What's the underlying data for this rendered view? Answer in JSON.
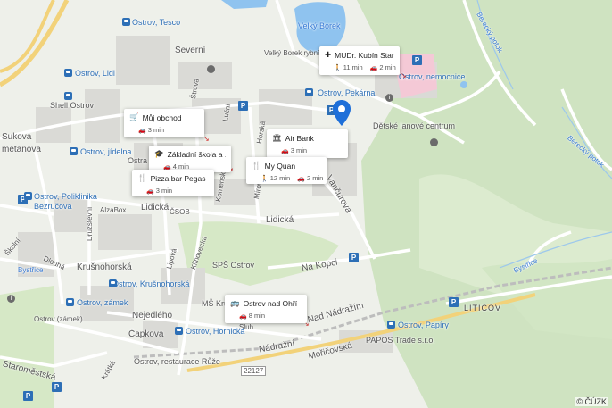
{
  "copyright": "© ČÚZK",
  "street_labels": [
    {
      "id": "sever",
      "text": "Severní"
    },
    {
      "id": "sukova",
      "text": "Sukova"
    },
    {
      "id": "smetanova",
      "text": "metanova"
    },
    {
      "id": "lidicka1",
      "text": "Lidická"
    },
    {
      "id": "lidicka2",
      "text": "Lidická"
    },
    {
      "id": "csob",
      "text": "ČSOB"
    },
    {
      "id": "druzstevni",
      "text": "Družstevní"
    },
    {
      "id": "krusnohorska",
      "text": "Krušnohorská"
    },
    {
      "id": "dlouha",
      "text": "Dlouhá"
    },
    {
      "id": "skolni",
      "text": "Školní"
    },
    {
      "id": "lipova",
      "text": "Lipová"
    },
    {
      "id": "klinovecka",
      "text": "Klínovecká"
    },
    {
      "id": "nakopci",
      "text": "Na Kopci"
    },
    {
      "id": "nejedleho",
      "text": "Nejedlého"
    },
    {
      "id": "capkova",
      "text": "Čapkova"
    },
    {
      "id": "staromestska",
      "text": "Staroměstská"
    },
    {
      "id": "krala",
      "text": "Krátká"
    },
    {
      "id": "nadrazni",
      "text": "Nádražní"
    },
    {
      "id": "nadnadrazim",
      "text": "Nad Nádražím"
    },
    {
      "id": "mostecka",
      "text": "Mořičovská"
    },
    {
      "id": "vancurova",
      "text": "Vančurova"
    },
    {
      "id": "horska",
      "text": "Horská"
    },
    {
      "id": "lucni",
      "text": "Luční"
    },
    {
      "id": "strova",
      "text": "Štrova"
    },
    {
      "id": "komenskeho",
      "text": "Komenského"
    },
    {
      "id": "mirova",
      "text": "Mírová"
    },
    {
      "id": "route",
      "text": "22127"
    },
    {
      "id": "berecky",
      "text": "Berecký potok"
    },
    {
      "id": "bystrice",
      "text": "Bystřice"
    },
    {
      "id": "bystrice2",
      "text": "Bystřice"
    },
    {
      "id": "sluh",
      "text": "Sluh"
    }
  ],
  "poi_labels": [
    {
      "id": "tesco",
      "text": "Ostrov, Tesco"
    },
    {
      "id": "lidl",
      "text": "Ostrov, Lidl"
    },
    {
      "id": "shell",
      "text": "Shell Ostrov"
    },
    {
      "id": "jidelna",
      "text": "Ostrov, jídelna"
    },
    {
      "id": "poliklinika",
      "text": "Ostrov, Poliklinika"
    },
    {
      "id": "bezrucova",
      "text": "Bezručova"
    },
    {
      "id": "alzabox",
      "text": "AlzaBox"
    },
    {
      "id": "pekarna",
      "text": "Ostrov, Pekárna"
    },
    {
      "id": "nemocnice",
      "text": "Ostrov, nemocnice"
    },
    {
      "id": "lanove",
      "text": "Dětské lanové centrum"
    },
    {
      "id": "zamek",
      "text": "Ostrov, zámek"
    },
    {
      "id": "zamek2",
      "text": "Ostrov (zámek)"
    },
    {
      "id": "krusnohorska",
      "text": "Ostrov, Krušnohorská"
    },
    {
      "id": "sps",
      "text": "SPŠ Ostrov"
    },
    {
      "id": "ms",
      "text": "MŠ Krus"
    },
    {
      "id": "hornicka",
      "text": "Ostrov, Hornická"
    },
    {
      "id": "ruze",
      "text": "Ostrov, restaurace Růže"
    },
    {
      "id": "papiry",
      "text": "Ostrov, Papíry"
    },
    {
      "id": "papos",
      "text": "PAPOS Trade s.r.o."
    },
    {
      "id": "velkyborek",
      "text": "Velký Borek"
    },
    {
      "id": "rybnik",
      "text": "Velký Borek rybník"
    },
    {
      "id": "liticov",
      "text": "LITICOV"
    },
    {
      "id": "stra",
      "text": "Ostra"
    }
  ],
  "cards": [
    {
      "id": "mudr",
      "title": "MUDr. Kubín Stan...",
      "icon": "✚",
      "walk": "11 min",
      "car": "2 min"
    },
    {
      "id": "obchod",
      "title": "Můj obchod",
      "icon": "🛒",
      "walk": "",
      "car": "3 min"
    },
    {
      "id": "airbank",
      "title": "Air Bank",
      "icon": "🏛",
      "walk": "",
      "car": "3 min"
    },
    {
      "id": "skola",
      "title": "Základní škola a ...",
      "icon": "🎓",
      "walk": "",
      "car": "4 min"
    },
    {
      "id": "myquan",
      "title": "My Quan",
      "icon": "🍴",
      "walk": "12 min",
      "car": "2 min"
    },
    {
      "id": "pizza",
      "title": "Pizza bar Pegas",
      "icon": "🍴",
      "walk": "",
      "car": "3 min"
    },
    {
      "id": "ostrovnadohri",
      "title": "Ostrov nad Ohří",
      "icon": "🚌",
      "walk": "",
      "car": "8 min"
    }
  ],
  "marker_color": "#1e6fd9",
  "colors": {
    "water": "#8fc3ef",
    "park": "#c8dfb8",
    "road": "#ffffff",
    "major_road": "#f6d77a",
    "building": "#d9d9d6"
  }
}
